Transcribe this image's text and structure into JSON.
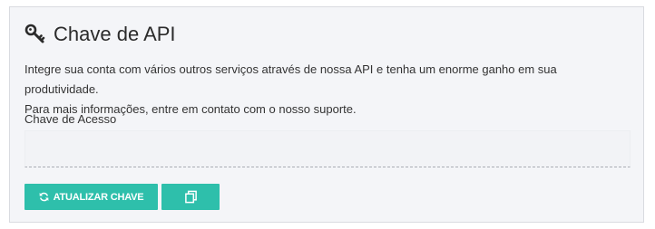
{
  "card": {
    "title": "Chave de API",
    "title_icon": "key-icon",
    "description_line1": "Integre sua conta com vários outros serviços através de nossa API e tenha um enorme ganho em sua produtividade.",
    "description_line2": "Para mais informações, entre em contato com o nosso suporte.",
    "field_label": "Chave de Acesso",
    "field_value": "",
    "update_button_label": "ATUALIZAR CHAVE",
    "update_button_icon": "refresh-icon",
    "copy_button_icon": "copy-icon"
  },
  "colors": {
    "accent": "#2ebfab",
    "panel_background": "#f4f5f8",
    "panel_border": "#d9dbe0",
    "text": "#333333"
  }
}
